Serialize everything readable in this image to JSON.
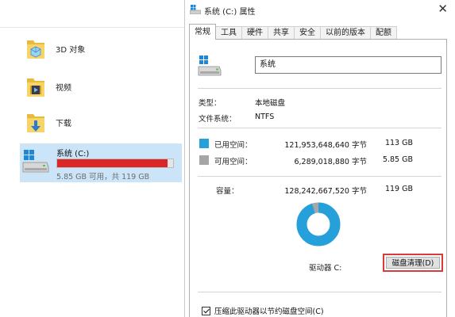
{
  "explorer": {
    "items": [
      {
        "label": "3D 对象",
        "icon": "3d-objects-folder-icon"
      },
      {
        "label": "视频",
        "icon": "videos-folder-icon"
      },
      {
        "label": "下载",
        "icon": "downloads-folder-icon"
      }
    ],
    "drive": {
      "name": "系统 (C:)",
      "free_text": "5.85 GB 可用，共 119 GB",
      "used_fraction": 0.951,
      "bar_color": "#da2626"
    }
  },
  "dialog": {
    "title": "系统 (C:) 属性",
    "close_glyph": "✕",
    "tabs": [
      {
        "label": "常规",
        "active": true
      },
      {
        "label": "工具"
      },
      {
        "label": "硬件"
      },
      {
        "label": "共享"
      },
      {
        "label": "安全"
      },
      {
        "label": "以前的版本"
      },
      {
        "label": "配额"
      }
    ],
    "general": {
      "drive_name": "系统",
      "type_label": "类型：",
      "type_value": "本地磁盘",
      "fs_label": "文件系统：",
      "fs_value": "NTFS",
      "used": {
        "label": "已用空间：",
        "bytes": "121,953,648,640 字节",
        "size": "113 GB",
        "color": "#26a0da"
      },
      "free": {
        "label": "可用空间：",
        "bytes": "6,289,018,880 字节",
        "size": "5.85 GB",
        "color": "#a6a6a6"
      },
      "capacity": {
        "label": "容量：",
        "bytes": "128,242,667,520 字节",
        "size": "119 GB"
      },
      "drive_label": "驱动器 C:",
      "cleanup_button": "磁盘清理(D)",
      "compress_checkbox": "压缩此驱动器以节约磁盘空间(C)",
      "compress_checked": true
    }
  }
}
